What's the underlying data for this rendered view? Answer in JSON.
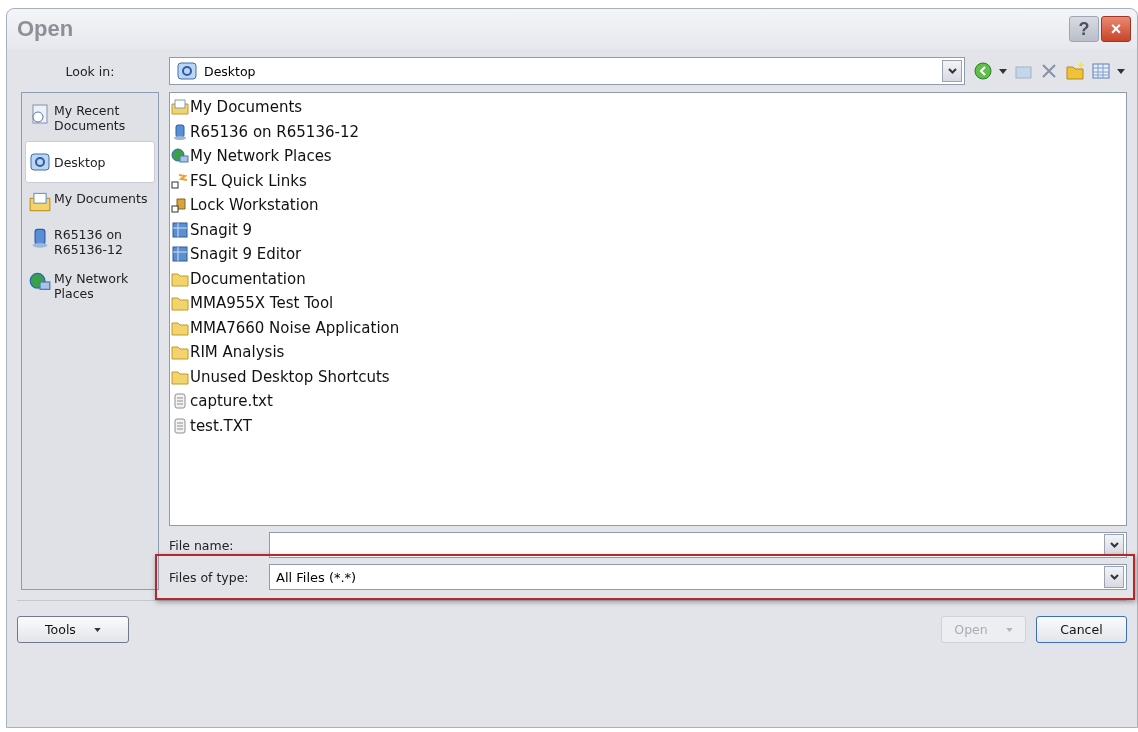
{
  "window": {
    "title": "Open",
    "help": "?",
    "close": "×"
  },
  "look_in": {
    "label": "Look in:",
    "value": "Desktop"
  },
  "sidebar": {
    "items": [
      {
        "label": "My Recent Documents",
        "kind": "recent",
        "selected": false
      },
      {
        "label": "Desktop",
        "kind": "desktop",
        "selected": true
      },
      {
        "label": "My Documents",
        "kind": "documents",
        "selected": false
      },
      {
        "label": "R65136 on R65136-12",
        "kind": "computer",
        "selected": false
      },
      {
        "label": "My Network Places",
        "kind": "network",
        "selected": false
      }
    ]
  },
  "files": [
    {
      "name": "My Documents",
      "kind": "documents"
    },
    {
      "name": "R65136 on R65136-12",
      "kind": "computer"
    },
    {
      "name": "My Network Places",
      "kind": "network"
    },
    {
      "name": "FSL Quick Links",
      "kind": "shortcut"
    },
    {
      "name": "Lock Workstation",
      "kind": "shortcut-app"
    },
    {
      "name": "Snagit 9",
      "kind": "app"
    },
    {
      "name": "Snagit 9 Editor",
      "kind": "app"
    },
    {
      "name": "Documentation",
      "kind": "folder"
    },
    {
      "name": "MMA955X Test Tool",
      "kind": "folder"
    },
    {
      "name": "MMA7660 Noise Application",
      "kind": "folder"
    },
    {
      "name": "RIM Analysis",
      "kind": "folder"
    },
    {
      "name": "Unused Desktop Shortcuts",
      "kind": "folder"
    },
    {
      "name": "capture.txt",
      "kind": "text"
    },
    {
      "name": "test.TXT",
      "kind": "text"
    }
  ],
  "file_name": {
    "label": "File name:"
  },
  "file_type": {
    "label": "Files of type:",
    "value": "All Files (*.*)"
  },
  "buttons": [
    {
      "label": "Tools",
      "kind": "menu",
      "disabled": false
    },
    {
      "label": "Open",
      "kind": "split",
      "disabled": true
    },
    {
      "label": "Cancel",
      "kind": "plain",
      "disabled": false
    }
  ]
}
